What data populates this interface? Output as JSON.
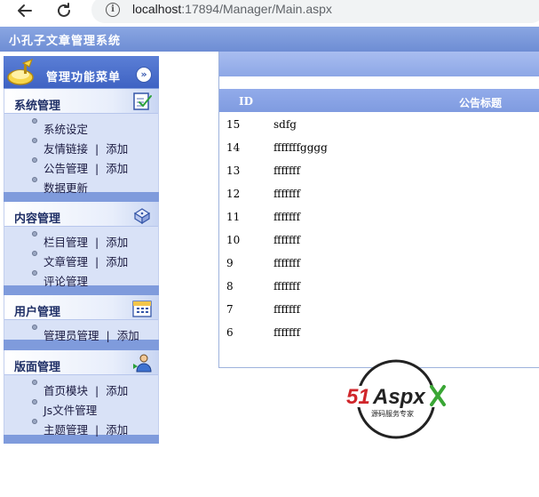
{
  "browser": {
    "back_icon": "arrow-left-icon",
    "reload_icon": "reload-icon",
    "info_icon": "info-icon",
    "url_host": "localhost",
    "url_rest": ":17894/Manager/Main.aspx"
  },
  "header": {
    "title": "小孔子文章管理系统"
  },
  "sidebar": {
    "menu_title": "管理功能菜单",
    "collapse_icon": "double-chevron-down-icon",
    "separator": "|",
    "groups": [
      {
        "title": "系统管理",
        "icon": "checklist-icon",
        "items": [
          {
            "label": "系统设定"
          },
          {
            "label": "友情链接",
            "add": "添加"
          },
          {
            "label": "公告管理",
            "add": "添加"
          },
          {
            "label": "数据更新"
          }
        ]
      },
      {
        "title": "内容管理",
        "icon": "dice-icon",
        "items": [
          {
            "label": "栏目管理",
            "add": "添加"
          },
          {
            "label": "文章管理",
            "add": "添加"
          },
          {
            "label": "评论管理"
          }
        ]
      },
      {
        "title": "用户管理",
        "icon": "calendar-icon",
        "items": [
          {
            "label": "管理员管理",
            "add": "添加"
          }
        ]
      },
      {
        "title": "版面管理",
        "icon": "user-icon",
        "items": [
          {
            "label": "首页模块",
            "add": "添加"
          },
          {
            "label": "Js文件管理"
          },
          {
            "label": "主题管理",
            "add": "添加"
          }
        ]
      }
    ]
  },
  "table": {
    "columns": [
      "ID",
      "公告标题"
    ],
    "rows": [
      {
        "id": "15",
        "title": "sdfg"
      },
      {
        "id": "14",
        "title": "fffffffgggg"
      },
      {
        "id": "13",
        "title": "fffffff"
      },
      {
        "id": "12",
        "title": "fffffff"
      },
      {
        "id": "11",
        "title": "fffffff"
      },
      {
        "id": "10",
        "title": "fffffff"
      },
      {
        "id": "9",
        "title": "fffffff"
      },
      {
        "id": "8",
        "title": "fffffff"
      },
      {
        "id": "7",
        "title": "fffffff"
      },
      {
        "id": "6",
        "title": "fffffff"
      }
    ]
  },
  "watermark": {
    "brand_num": "51",
    "brand_text": "Aspx",
    "tagline": "源码服务专家"
  }
}
